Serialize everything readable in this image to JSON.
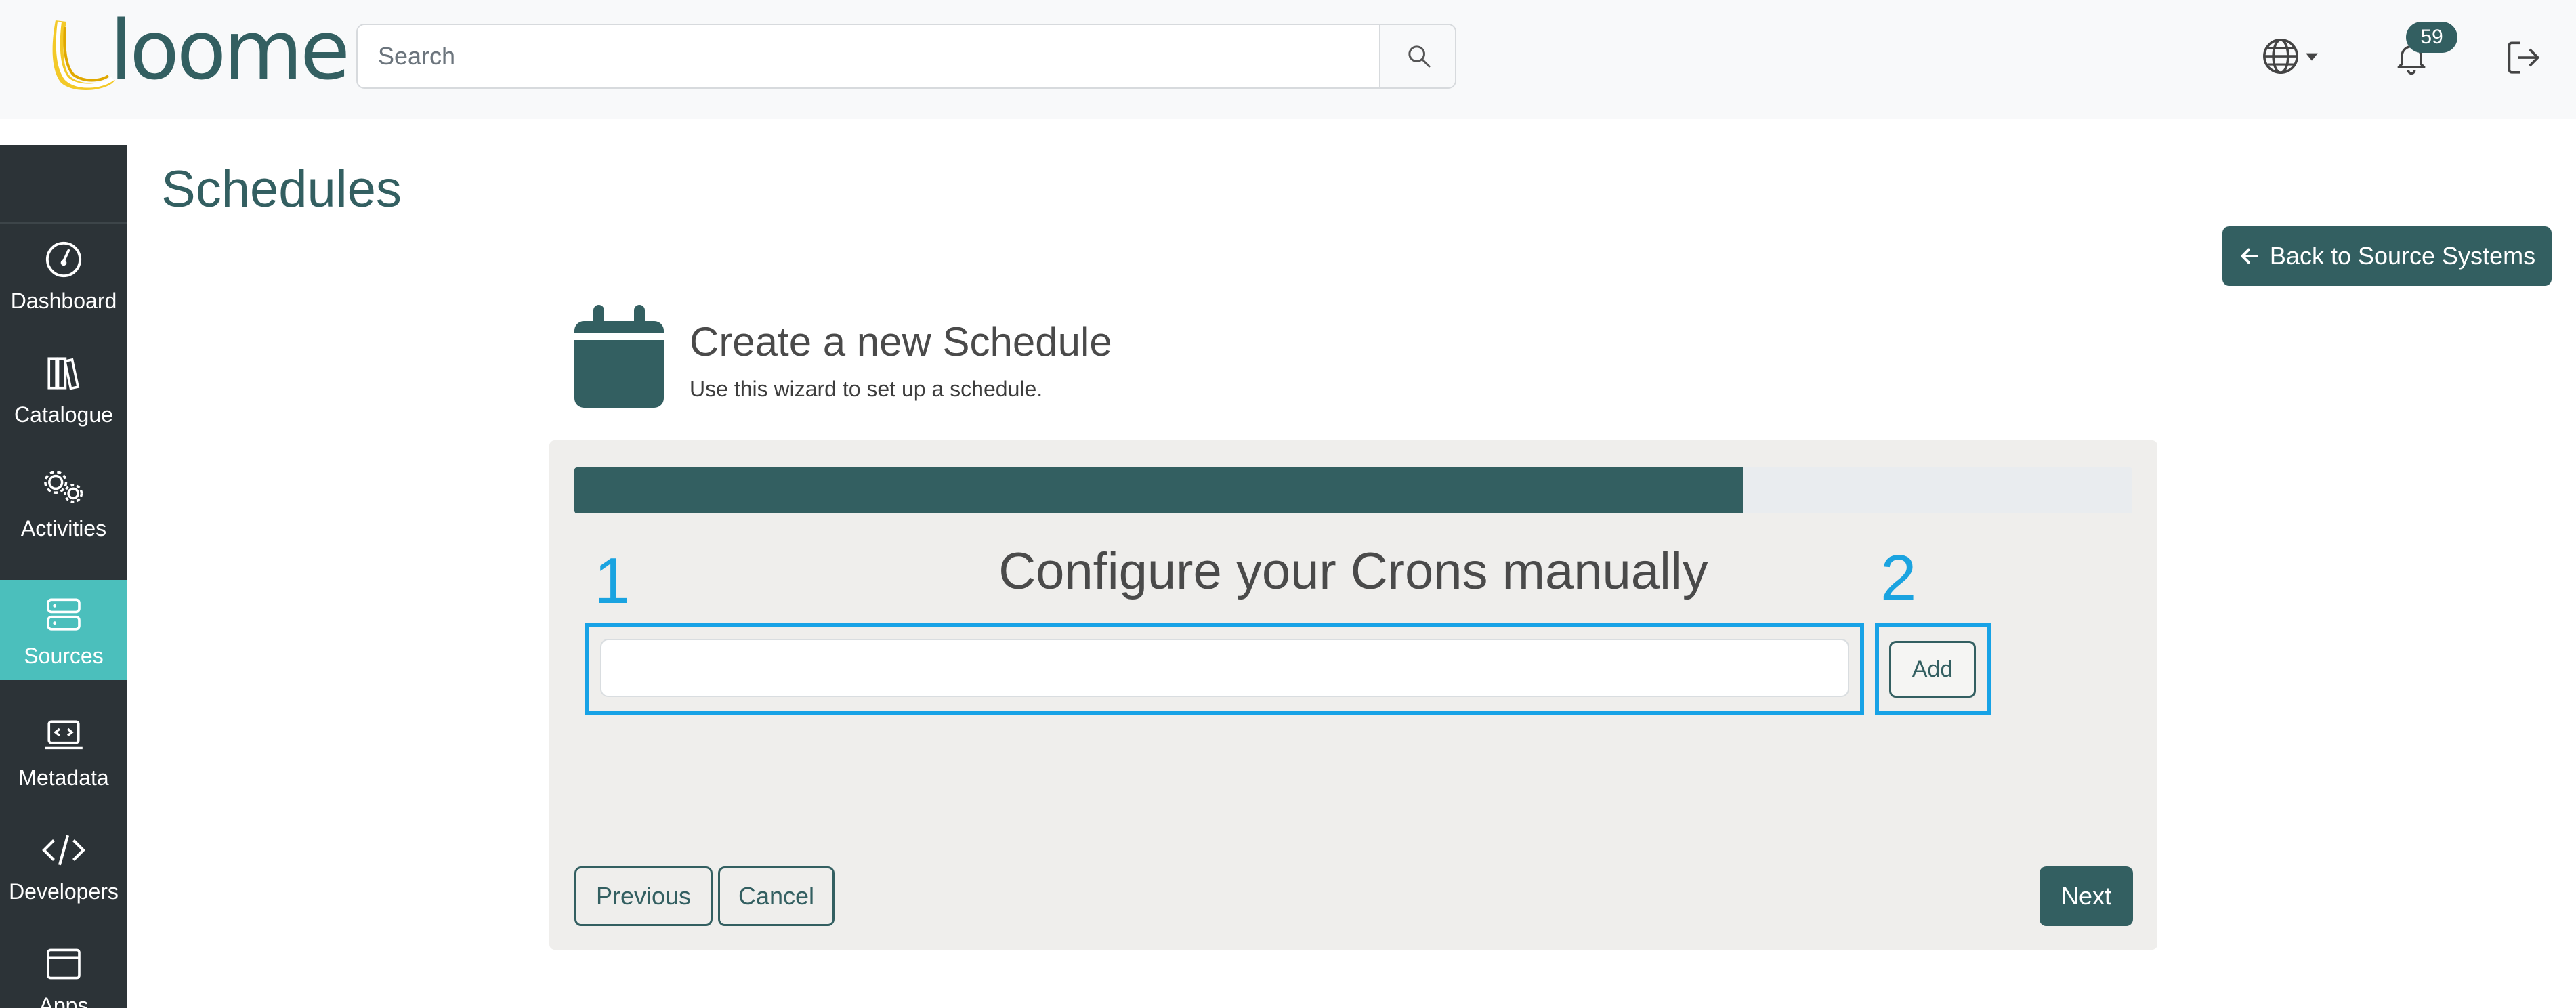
{
  "header": {
    "logo_text": "loome",
    "search_placeholder": "Search",
    "notification_count": "59"
  },
  "sidebar": {
    "items": [
      {
        "label": "Dashboard",
        "icon": "gauge-icon"
      },
      {
        "label": "Catalogue",
        "icon": "books-icon"
      },
      {
        "label": "Activities",
        "icon": "gears-icon"
      },
      {
        "label": "Sources",
        "icon": "server-icon",
        "active": true
      },
      {
        "label": "Metadata",
        "icon": "laptop-code-icon"
      },
      {
        "label": "Developers",
        "icon": "code-icon"
      },
      {
        "label": "Apps",
        "icon": "window-icon"
      }
    ]
  },
  "page": {
    "title": "Schedules",
    "back_button_label": "Back to Source Systems"
  },
  "wizard": {
    "title": "Create a new Schedule",
    "subtitle": "Use this wizard to set up a schedule.",
    "progress_percent": 75,
    "step_title": "Configure your Crons manually",
    "cron_input_value": "",
    "add_label": "Add",
    "annotation_1": "1",
    "annotation_2": "2",
    "previous_label": "Previous",
    "cancel_label": "Cancel",
    "next_label": "Next"
  },
  "colors": {
    "brand": "#335f61",
    "sidebar_bg": "#2c3337",
    "active_nav": "#4bbfbc",
    "highlight": "#17a2e6",
    "logo_yellow": "#f3c928"
  }
}
